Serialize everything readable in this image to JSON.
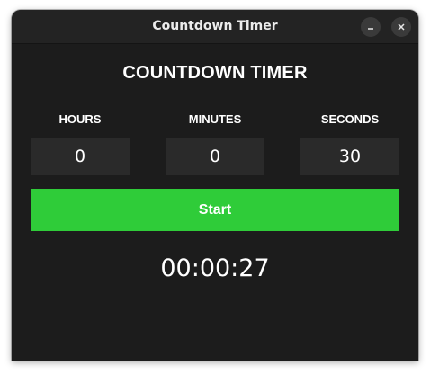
{
  "window": {
    "title": "Countdown Timer"
  },
  "titlebar": {
    "minimize_icon": "minimize-icon",
    "close_icon": "close-icon"
  },
  "main": {
    "heading": "COUNTDOWN TIMER",
    "fields": [
      {
        "label": "HOURS",
        "value": "0"
      },
      {
        "label": "MINUTES",
        "value": "0"
      },
      {
        "label": "SECONDS",
        "value": "30"
      }
    ],
    "start_label": "Start",
    "countdown_display": "00:00:27"
  },
  "colors": {
    "background": "#1c1c1c",
    "titlebar": "#232323",
    "field_background": "#2a2a2a",
    "start_button": "#2fcc39",
    "text": "#ffffff"
  }
}
